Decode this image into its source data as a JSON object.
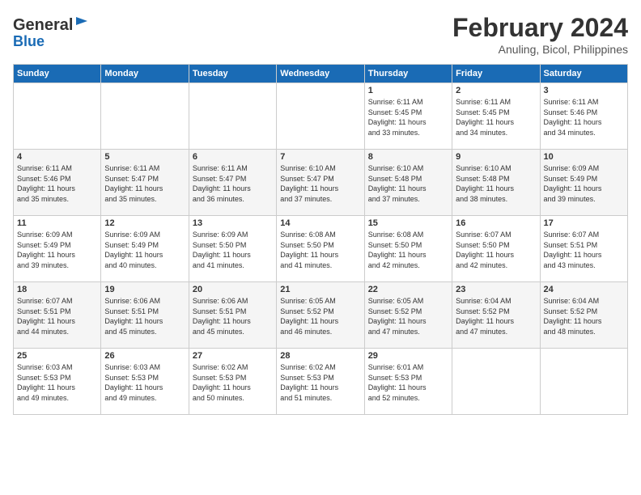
{
  "header": {
    "logo_line1": "General",
    "logo_line2": "Blue",
    "title": "February 2024",
    "subtitle": "Anuling, Bicol, Philippines"
  },
  "calendar": {
    "columns": [
      "Sunday",
      "Monday",
      "Tuesday",
      "Wednesday",
      "Thursday",
      "Friday",
      "Saturday"
    ],
    "weeks": [
      [
        {
          "day": "",
          "info": ""
        },
        {
          "day": "",
          "info": ""
        },
        {
          "day": "",
          "info": ""
        },
        {
          "day": "",
          "info": ""
        },
        {
          "day": "1",
          "info": "Sunrise: 6:11 AM\nSunset: 5:45 PM\nDaylight: 11 hours\nand 33 minutes."
        },
        {
          "day": "2",
          "info": "Sunrise: 6:11 AM\nSunset: 5:45 PM\nDaylight: 11 hours\nand 34 minutes."
        },
        {
          "day": "3",
          "info": "Sunrise: 6:11 AM\nSunset: 5:46 PM\nDaylight: 11 hours\nand 34 minutes."
        }
      ],
      [
        {
          "day": "4",
          "info": "Sunrise: 6:11 AM\nSunset: 5:46 PM\nDaylight: 11 hours\nand 35 minutes."
        },
        {
          "day": "5",
          "info": "Sunrise: 6:11 AM\nSunset: 5:47 PM\nDaylight: 11 hours\nand 35 minutes."
        },
        {
          "day": "6",
          "info": "Sunrise: 6:11 AM\nSunset: 5:47 PM\nDaylight: 11 hours\nand 36 minutes."
        },
        {
          "day": "7",
          "info": "Sunrise: 6:10 AM\nSunset: 5:47 PM\nDaylight: 11 hours\nand 37 minutes."
        },
        {
          "day": "8",
          "info": "Sunrise: 6:10 AM\nSunset: 5:48 PM\nDaylight: 11 hours\nand 37 minutes."
        },
        {
          "day": "9",
          "info": "Sunrise: 6:10 AM\nSunset: 5:48 PM\nDaylight: 11 hours\nand 38 minutes."
        },
        {
          "day": "10",
          "info": "Sunrise: 6:09 AM\nSunset: 5:49 PM\nDaylight: 11 hours\nand 39 minutes."
        }
      ],
      [
        {
          "day": "11",
          "info": "Sunrise: 6:09 AM\nSunset: 5:49 PM\nDaylight: 11 hours\nand 39 minutes."
        },
        {
          "day": "12",
          "info": "Sunrise: 6:09 AM\nSunset: 5:49 PM\nDaylight: 11 hours\nand 40 minutes."
        },
        {
          "day": "13",
          "info": "Sunrise: 6:09 AM\nSunset: 5:50 PM\nDaylight: 11 hours\nand 41 minutes."
        },
        {
          "day": "14",
          "info": "Sunrise: 6:08 AM\nSunset: 5:50 PM\nDaylight: 11 hours\nand 41 minutes."
        },
        {
          "day": "15",
          "info": "Sunrise: 6:08 AM\nSunset: 5:50 PM\nDaylight: 11 hours\nand 42 minutes."
        },
        {
          "day": "16",
          "info": "Sunrise: 6:07 AM\nSunset: 5:50 PM\nDaylight: 11 hours\nand 42 minutes."
        },
        {
          "day": "17",
          "info": "Sunrise: 6:07 AM\nSunset: 5:51 PM\nDaylight: 11 hours\nand 43 minutes."
        }
      ],
      [
        {
          "day": "18",
          "info": "Sunrise: 6:07 AM\nSunset: 5:51 PM\nDaylight: 11 hours\nand 44 minutes."
        },
        {
          "day": "19",
          "info": "Sunrise: 6:06 AM\nSunset: 5:51 PM\nDaylight: 11 hours\nand 45 minutes."
        },
        {
          "day": "20",
          "info": "Sunrise: 6:06 AM\nSunset: 5:51 PM\nDaylight: 11 hours\nand 45 minutes."
        },
        {
          "day": "21",
          "info": "Sunrise: 6:05 AM\nSunset: 5:52 PM\nDaylight: 11 hours\nand 46 minutes."
        },
        {
          "day": "22",
          "info": "Sunrise: 6:05 AM\nSunset: 5:52 PM\nDaylight: 11 hours\nand 47 minutes."
        },
        {
          "day": "23",
          "info": "Sunrise: 6:04 AM\nSunset: 5:52 PM\nDaylight: 11 hours\nand 47 minutes."
        },
        {
          "day": "24",
          "info": "Sunrise: 6:04 AM\nSunset: 5:52 PM\nDaylight: 11 hours\nand 48 minutes."
        }
      ],
      [
        {
          "day": "25",
          "info": "Sunrise: 6:03 AM\nSunset: 5:53 PM\nDaylight: 11 hours\nand 49 minutes."
        },
        {
          "day": "26",
          "info": "Sunrise: 6:03 AM\nSunset: 5:53 PM\nDaylight: 11 hours\nand 49 minutes."
        },
        {
          "day": "27",
          "info": "Sunrise: 6:02 AM\nSunset: 5:53 PM\nDaylight: 11 hours\nand 50 minutes."
        },
        {
          "day": "28",
          "info": "Sunrise: 6:02 AM\nSunset: 5:53 PM\nDaylight: 11 hours\nand 51 minutes."
        },
        {
          "day": "29",
          "info": "Sunrise: 6:01 AM\nSunset: 5:53 PM\nDaylight: 11 hours\nand 52 minutes."
        },
        {
          "day": "",
          "info": ""
        },
        {
          "day": "",
          "info": ""
        }
      ]
    ]
  }
}
